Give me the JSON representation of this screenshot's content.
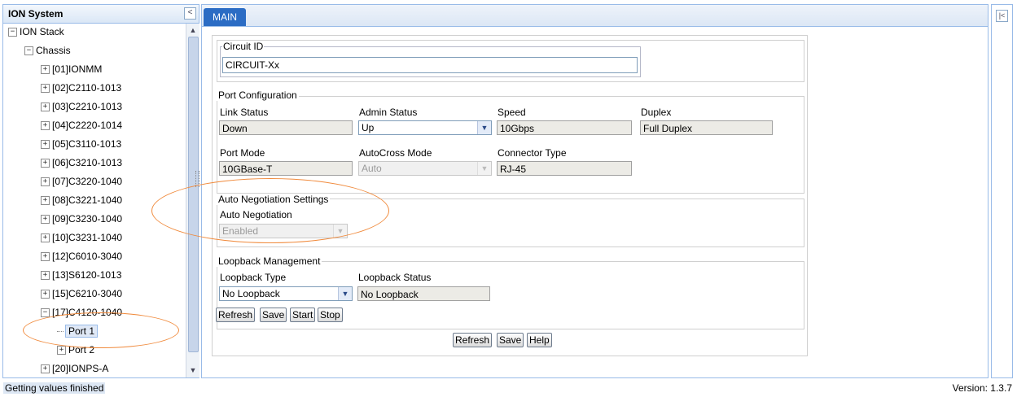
{
  "tree": {
    "title": "ION System",
    "collapse_icon": "<",
    "nodes": [
      {
        "label": "ION Stack",
        "toggle": "−"
      },
      {
        "label": "Chassis",
        "toggle": "−"
      },
      {
        "label": "[01]IONMM",
        "toggle": "+"
      },
      {
        "label": "[02]C2110-1013",
        "toggle": "+"
      },
      {
        "label": "[03]C2210-1013",
        "toggle": "+"
      },
      {
        "label": "[04]C2220-1014",
        "toggle": "+"
      },
      {
        "label": "[05]C3110-1013",
        "toggle": "+"
      },
      {
        "label": "[06]C3210-1013",
        "toggle": "+"
      },
      {
        "label": "[07]C3220-1040",
        "toggle": "+"
      },
      {
        "label": "[08]C3221-1040",
        "toggle": "+"
      },
      {
        "label": "[09]C3230-1040",
        "toggle": "+"
      },
      {
        "label": "[10]C3231-1040",
        "toggle": "+"
      },
      {
        "label": "[12]C6010-3040",
        "toggle": "+"
      },
      {
        "label": "[13]S6120-1013",
        "toggle": "+"
      },
      {
        "label": "[15]C6210-3040",
        "toggle": "+"
      },
      {
        "label": "[17]C4120-1040",
        "toggle": "−"
      },
      {
        "label": "Port 1",
        "toggle": ""
      },
      {
        "label": "Port 2",
        "toggle": "+"
      },
      {
        "label": "[20]IONPS-A",
        "toggle": "+"
      }
    ]
  },
  "main": {
    "tab_label": "MAIN",
    "circuit": {
      "legend": "Circuit ID",
      "value": "CIRCUIT-Xx"
    },
    "port_config": {
      "title": "Port Configuration",
      "link_status": {
        "label": "Link Status",
        "value": "Down"
      },
      "admin_status": {
        "label": "Admin Status",
        "value": "Up"
      },
      "speed": {
        "label": "Speed",
        "value": "10Gbps"
      },
      "duplex": {
        "label": "Duplex",
        "value": "Full Duplex"
      },
      "port_mode": {
        "label": "Port Mode",
        "value": "10GBase-T"
      },
      "autocross": {
        "label": "AutoCross Mode",
        "value": "Auto"
      },
      "connector": {
        "label": "Connector Type",
        "value": "RJ-45"
      }
    },
    "auto_neg": {
      "title": "Auto Negotiation Settings",
      "label": "Auto Negotiation",
      "value": "Enabled"
    },
    "loopback": {
      "title": "Loopback Management",
      "type_label": "Loopback Type",
      "type_value": "No Loopback",
      "status_label": "Loopback Status",
      "status_value": "No Loopback",
      "buttons": [
        "Refresh",
        "Save",
        "Start",
        "Stop"
      ]
    },
    "footer_buttons": [
      "Refresh",
      "Save",
      "Help"
    ]
  },
  "right_panel": {
    "expand_icon": "|<"
  },
  "status": {
    "text": "Getting values finished",
    "version": "Version: 1.3.7"
  },
  "colors": {
    "accent": "#2b6cc4",
    "annotation": "#f08a3c"
  }
}
